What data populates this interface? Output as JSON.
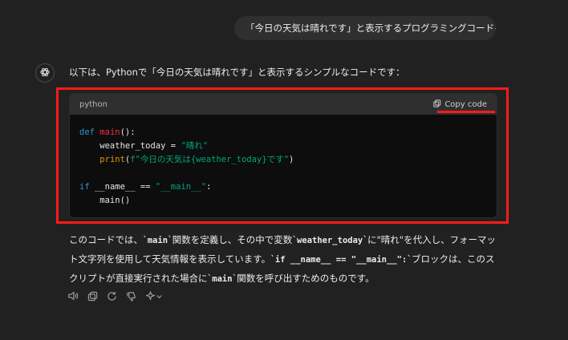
{
  "user_message": "「今日の天気は晴れです」と表示するプログラミングコードを書いて",
  "assistant": {
    "intro": "以下は、Pythonで「今日の天気は晴れです」と表示するシンプルなコードです：",
    "code_block": {
      "language": "python",
      "copy_label": "Copy code",
      "lines": {
        "l1_kw": "def",
        "l1_fn": "main",
        "l1_rest": "():",
        "l2_var": "    weather_today = ",
        "l2_str": "\"晴れ\"",
        "l3_indent": "    ",
        "l3_print": "print",
        "l3_open": "(",
        "l3_str": "f\"今日の天気は{weather_today}です\"",
        "l3_close": ")",
        "l5_kw": "if",
        "l5_mid": " __name__ == ",
        "l5_str": "\"__main__\"",
        "l5_end": ":",
        "l6": "    main()"
      }
    },
    "explanation": {
      "p1": "このコードでは、`",
      "c1": "main",
      "p2": "`関数を定義し、その中で変数`",
      "c2": "weather_today",
      "p3": "`に\"晴れ\"を代入し、フォーマット文字列を使用して天気情報を表示しています。`",
      "c3": "if __name__ == \"__main__\":",
      "p4": "`ブロックは、このスクリプトが直接実行された場合に`",
      "c4": "main",
      "p5": "`関数を呼び出すためのものです。"
    }
  },
  "icons": [
    "openai-logo-icon",
    "speaker-icon",
    "copy-icon",
    "regenerate-icon",
    "thumbs-down-icon",
    "model-sparkle-icon",
    "chevron-down-icon"
  ],
  "colors": {
    "background": "#212121",
    "user_bubble": "#2f2f2f",
    "code_bg": "#0d0d0d",
    "highlight_red": "#ff1a1a",
    "keyword": "#2e95d3",
    "function": "#f22c3d",
    "string": "#00a67d",
    "builtin": "#e9950c"
  }
}
